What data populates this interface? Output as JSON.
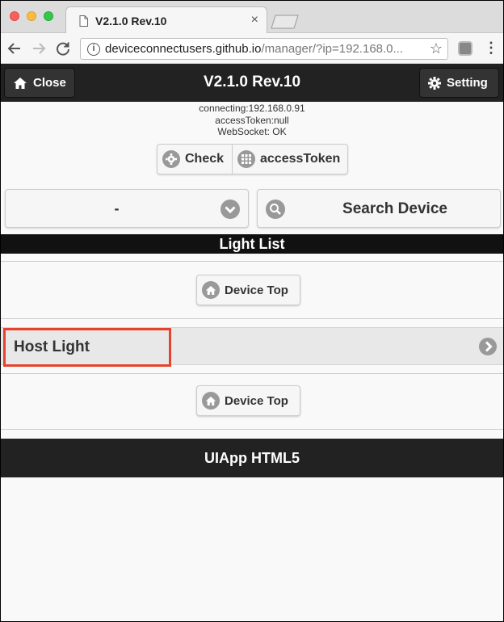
{
  "browser": {
    "tab_title": "V2.1.0 Rev.10",
    "url_host": "deviceconnectusers.github.io",
    "url_rest": "/manager/?ip=192.168.0...",
    "tab_close": "×"
  },
  "header": {
    "close_label": "Close",
    "title": "V2.1.0 Rev.10",
    "setting_label": "Setting"
  },
  "status": {
    "connecting": "connecting:192.168.0.91",
    "access_token": "accessToken:null",
    "websocket": "WebSocket: OK"
  },
  "actions": {
    "check_label": "Check",
    "token_label": "accessToken"
  },
  "device_select": {
    "selected": "-"
  },
  "search": {
    "label": "Search Device"
  },
  "list": {
    "header": "Light List",
    "device_top_label": "Device Top",
    "items": [
      {
        "label": "Host Light"
      }
    ]
  },
  "footer": {
    "text": "UIApp HTML5"
  },
  "colors": {
    "header_bg": "#222222",
    "highlight": "#e5432c",
    "icon_gray": "#999999"
  }
}
